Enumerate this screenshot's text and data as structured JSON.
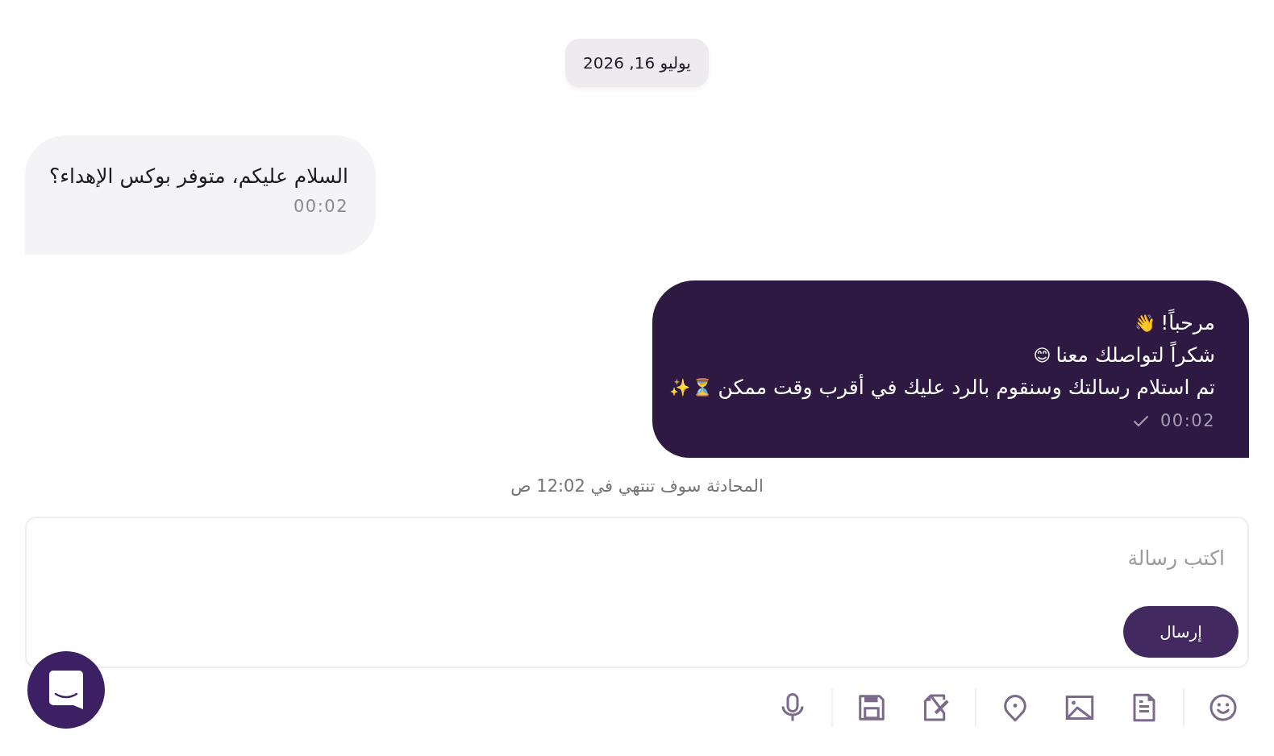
{
  "date_divider": "يوليو 16, 2026",
  "messages": [
    {
      "kind": "incoming",
      "lines": [
        {
          "text": "السلام عليكم، متوفر بوكس الإهداء؟"
        }
      ],
      "time": "00:02",
      "delivered": false
    },
    {
      "kind": "outgoing",
      "lines": [
        {
          "text": "مرحباً!",
          "emoji": [
            "👋"
          ]
        },
        {
          "text": "شكراً لتواصلك معنا",
          "emoji": [
            "😊"
          ]
        },
        {
          "text": "تم استلام رسالتك وسنقوم بالرد عليك في أقرب وقت ممكن",
          "emoji": [
            "⏳",
            "✨"
          ]
        }
      ],
      "time": "00:02",
      "delivered": true
    }
  ],
  "expiry_notice": "المحادثة سوف تنتهي في 12:02 ص",
  "composer": {
    "placeholder": "اكتب رسالة",
    "send_label": "إرسال"
  }
}
